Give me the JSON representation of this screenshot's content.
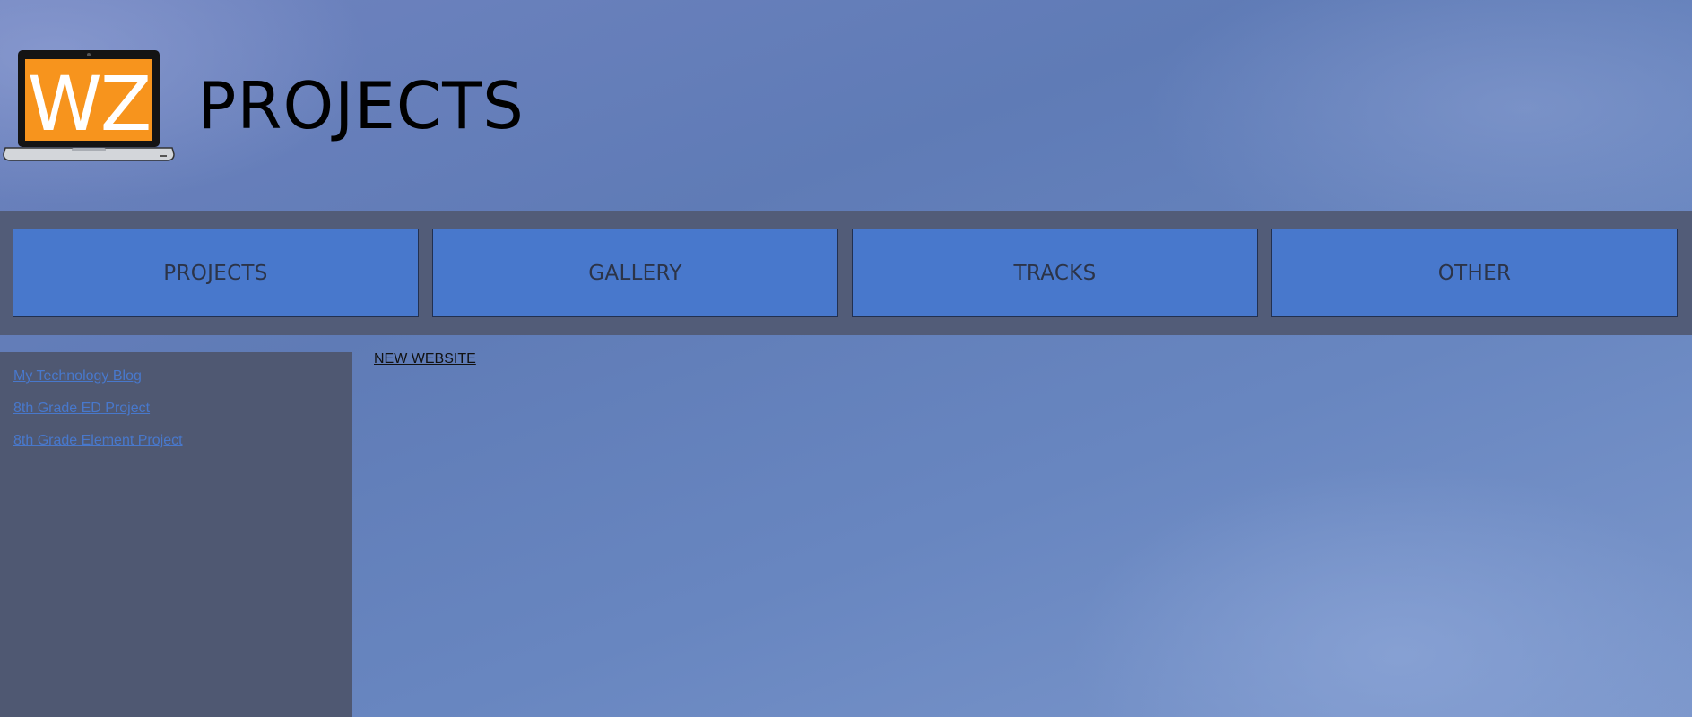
{
  "header": {
    "logo_text": "WZ",
    "title": "PROJECTS",
    "logo_colors": {
      "screen": "#f7941d",
      "bezel": "#111111",
      "base": "#cfd2d6"
    }
  },
  "nav": {
    "items": [
      {
        "label": "PROJECTS"
      },
      {
        "label": "GALLERY"
      },
      {
        "label": "TRACKS"
      },
      {
        "label": "OTHER"
      }
    ]
  },
  "sidebar": {
    "links": [
      {
        "label": "My Technology Blog"
      },
      {
        "label": "8th Grade ED Project"
      },
      {
        "label": "8th Grade Element Project"
      }
    ]
  },
  "main": {
    "link": "NEW WEBSITE"
  },
  "colors": {
    "navbar_bg": "#525c78",
    "nav_button_bg": "#4878cc",
    "sidebar_bg": "#4f5872",
    "link": "#4878cc"
  }
}
